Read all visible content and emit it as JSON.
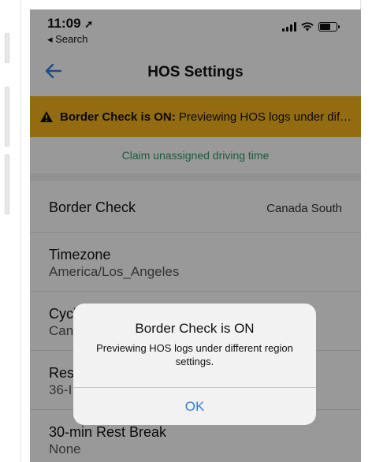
{
  "status_bar": {
    "time": "11:09",
    "location_icon": "location-arrow-icon",
    "back_app_label": "◂ Search",
    "icons": [
      "signal-icon",
      "wifi-icon",
      "battery-icon"
    ]
  },
  "nav": {
    "back_icon": "arrow-left-icon",
    "title": "HOS Settings"
  },
  "banner": {
    "icon": "warning-icon",
    "bold": "Border Check is ON:",
    "text": " Previewing HOS logs under different region settings."
  },
  "claim_link": "Claim unassigned driving time",
  "settings": {
    "border_check": {
      "label": "Border Check",
      "value": "Canada South"
    },
    "timezone": {
      "label": "Timezone",
      "value": "America/Los_Angeles"
    },
    "cycle": {
      "label": "Cycl",
      "value": "Can"
    },
    "restart": {
      "label": "Rest",
      "value": "36-I"
    },
    "rest_break": {
      "label": "30-min Rest Break",
      "value": "None"
    }
  },
  "alert": {
    "title": "Border Check is ON",
    "message": "Previewing HOS logs under different region settings.",
    "ok_label": "OK"
  },
  "colors": {
    "banner_bg": "#f5b21c",
    "link_green": "#2d9b64",
    "ios_blue": "#2f7de1",
    "overlay": "rgba(0,0,0,0.4)"
  }
}
